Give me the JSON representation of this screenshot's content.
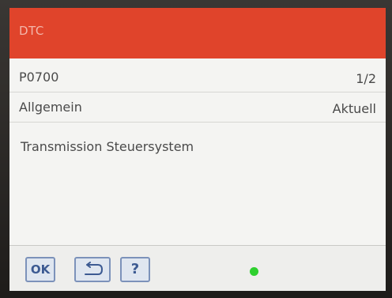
{
  "header": {
    "title": "DTC"
  },
  "code_row": {
    "code": "P0700",
    "page": "1/2"
  },
  "type_row": {
    "category": "Allgemein",
    "status": "Aktuell"
  },
  "description": "Transmission Steuersystem",
  "footer": {
    "ok_label": "OK",
    "help_label": "?",
    "indicator_color": "#2ed02e"
  },
  "colors": {
    "title_bar": "#e0442b",
    "button_border": "#7c92ba"
  }
}
